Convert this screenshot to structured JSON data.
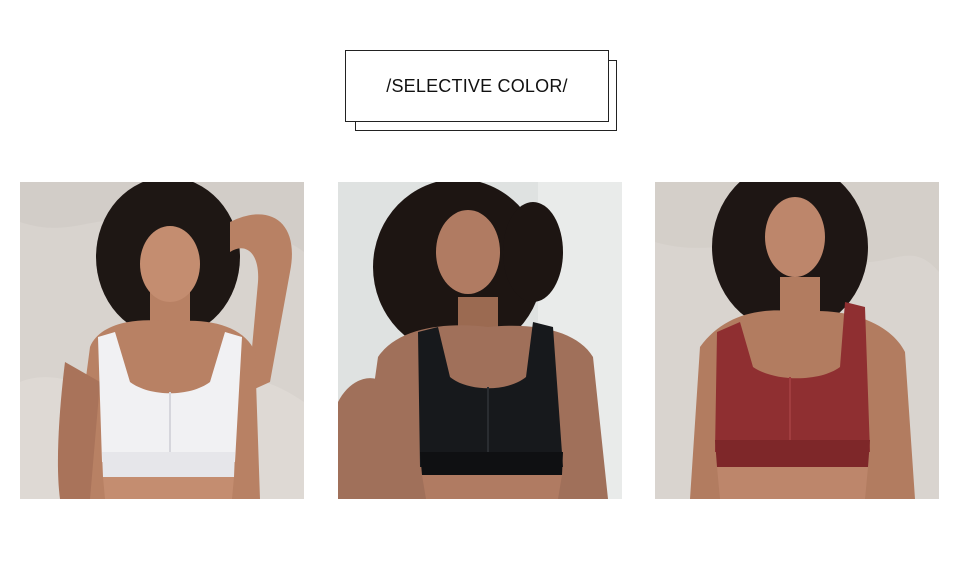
{
  "title": "/SELECTIVE COLOR/",
  "products": [
    {
      "color_name": "white",
      "bra_color": "#f1f1f3",
      "bg_color": "#d8d3ce"
    },
    {
      "color_name": "black",
      "bra_color": "#17191c",
      "bg_color": "#dfe2e1"
    },
    {
      "color_name": "red",
      "bra_color": "#8f2f31",
      "bg_color": "#d9d4cf"
    }
  ]
}
